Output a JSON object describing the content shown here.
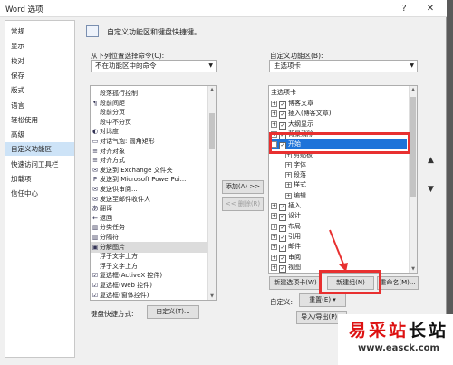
{
  "window": {
    "title": "Word 选项",
    "help": "?",
    "close": "✕"
  },
  "nav": {
    "items": [
      "常规",
      "显示",
      "校对",
      "保存",
      "版式",
      "语言",
      "轻松使用",
      "高级",
      "自定义功能区",
      "快速访问工具栏",
      "加载项",
      "信任中心"
    ],
    "selected": 8
  },
  "header": {
    "text": "自定义功能区和键盘快捷键。"
  },
  "left": {
    "choose_label": "从下列位置选择命令(C):",
    "choose_value": "不在功能区中的命令",
    "commands": [
      {
        "icon": "",
        "label": "段落孤行控制"
      },
      {
        "icon": "paragraph-after-icon",
        "label": "段前间距"
      },
      {
        "icon": "",
        "label": "段前分页"
      },
      {
        "icon": "",
        "label": "段中不分页"
      },
      {
        "icon": "contrast-icon",
        "label": "对比度"
      },
      {
        "icon": "callout-icon",
        "label": "对话气泡: 圆角矩形"
      },
      {
        "icon": "align-icon",
        "label": "对齐对象"
      },
      {
        "icon": "align-icon",
        "label": "对齐方式"
      },
      {
        "icon": "mail-icon",
        "label": "发送到 Exchange 文件夹"
      },
      {
        "icon": "ppt-icon",
        "label": "发送到 Microsoft PowerPoi..."
      },
      {
        "icon": "mail-icon",
        "label": "发送供审阅..."
      },
      {
        "icon": "mail-icon",
        "label": "发送至邮件收件人"
      },
      {
        "icon": "translate-icon",
        "label": "翻译"
      },
      {
        "icon": "back-icon",
        "label": "返回"
      },
      {
        "icon": "columns-icon",
        "label": "分类任务"
      },
      {
        "icon": "columns-icon",
        "label": "分隔符"
      },
      {
        "icon": "picture-icon",
        "label": "分解图片"
      },
      {
        "icon": "",
        "label": "浮于文字上方"
      },
      {
        "icon": "",
        "label": "浮于文字上方"
      },
      {
        "icon": "checkbox-icon",
        "label": "复选框(ActiveX 控件)"
      },
      {
        "icon": "checkbox-icon",
        "label": "复选框(Web 控件)"
      },
      {
        "icon": "checkbox-icon",
        "label": "复选框(窗体控件)"
      }
    ],
    "shortcut_label": "键盘快捷方式:",
    "shortcut_button": "自定义(T)..."
  },
  "middle": {
    "add": "添加(A) >>",
    "remove": "<< 删除(R)"
  },
  "right": {
    "customize_label": "自定义功能区(B):",
    "customize_value": "主选项卡",
    "tree_header": "主选项卡",
    "tree": [
      {
        "level": 0,
        "exp": "+",
        "check": true,
        "label": "博客文章"
      },
      {
        "level": 0,
        "exp": "+",
        "check": true,
        "label": "插入(博客文章)"
      },
      {
        "level": 0,
        "exp": "+",
        "check": true,
        "label": "大纲显示"
      },
      {
        "level": 0,
        "exp": "+",
        "check": true,
        "label": "背景消除"
      },
      {
        "level": 0,
        "exp": "−",
        "check": true,
        "label": "开始",
        "selected": true
      },
      {
        "level": 1,
        "exp": "+",
        "check": false,
        "label": "剪贴板"
      },
      {
        "level": 1,
        "exp": "+",
        "check": false,
        "label": "字体"
      },
      {
        "level": 1,
        "exp": "+",
        "check": false,
        "label": "段落"
      },
      {
        "level": 1,
        "exp": "+",
        "check": false,
        "label": "样式"
      },
      {
        "level": 1,
        "exp": "+",
        "check": false,
        "label": "编辑"
      },
      {
        "level": 0,
        "exp": "+",
        "check": true,
        "label": "插入"
      },
      {
        "level": 0,
        "exp": "+",
        "check": true,
        "label": "设计"
      },
      {
        "level": 0,
        "exp": "+",
        "check": true,
        "label": "布局"
      },
      {
        "level": 0,
        "exp": "+",
        "check": true,
        "label": "引用"
      },
      {
        "level": 0,
        "exp": "+",
        "check": true,
        "label": "邮件"
      },
      {
        "level": 0,
        "exp": "+",
        "check": true,
        "label": "审阅"
      },
      {
        "level": 0,
        "exp": "+",
        "check": true,
        "label": "视图"
      }
    ],
    "new_tab": "新建选项卡(W)",
    "new_group": "新建组(N)",
    "rename": "重命名(M)...",
    "customize_label2": "自定义:",
    "reset": "重置(E) ▾",
    "import_export": "导入/导出(P) ▾"
  },
  "watermark": {
    "cn_red": "易采站",
    "cn_black": "长站",
    "url": "www.easck.com"
  },
  "colors": {
    "accent": "#1e73d9",
    "highlight_box": "#e83030",
    "nav_selected": "#cde3f7"
  }
}
